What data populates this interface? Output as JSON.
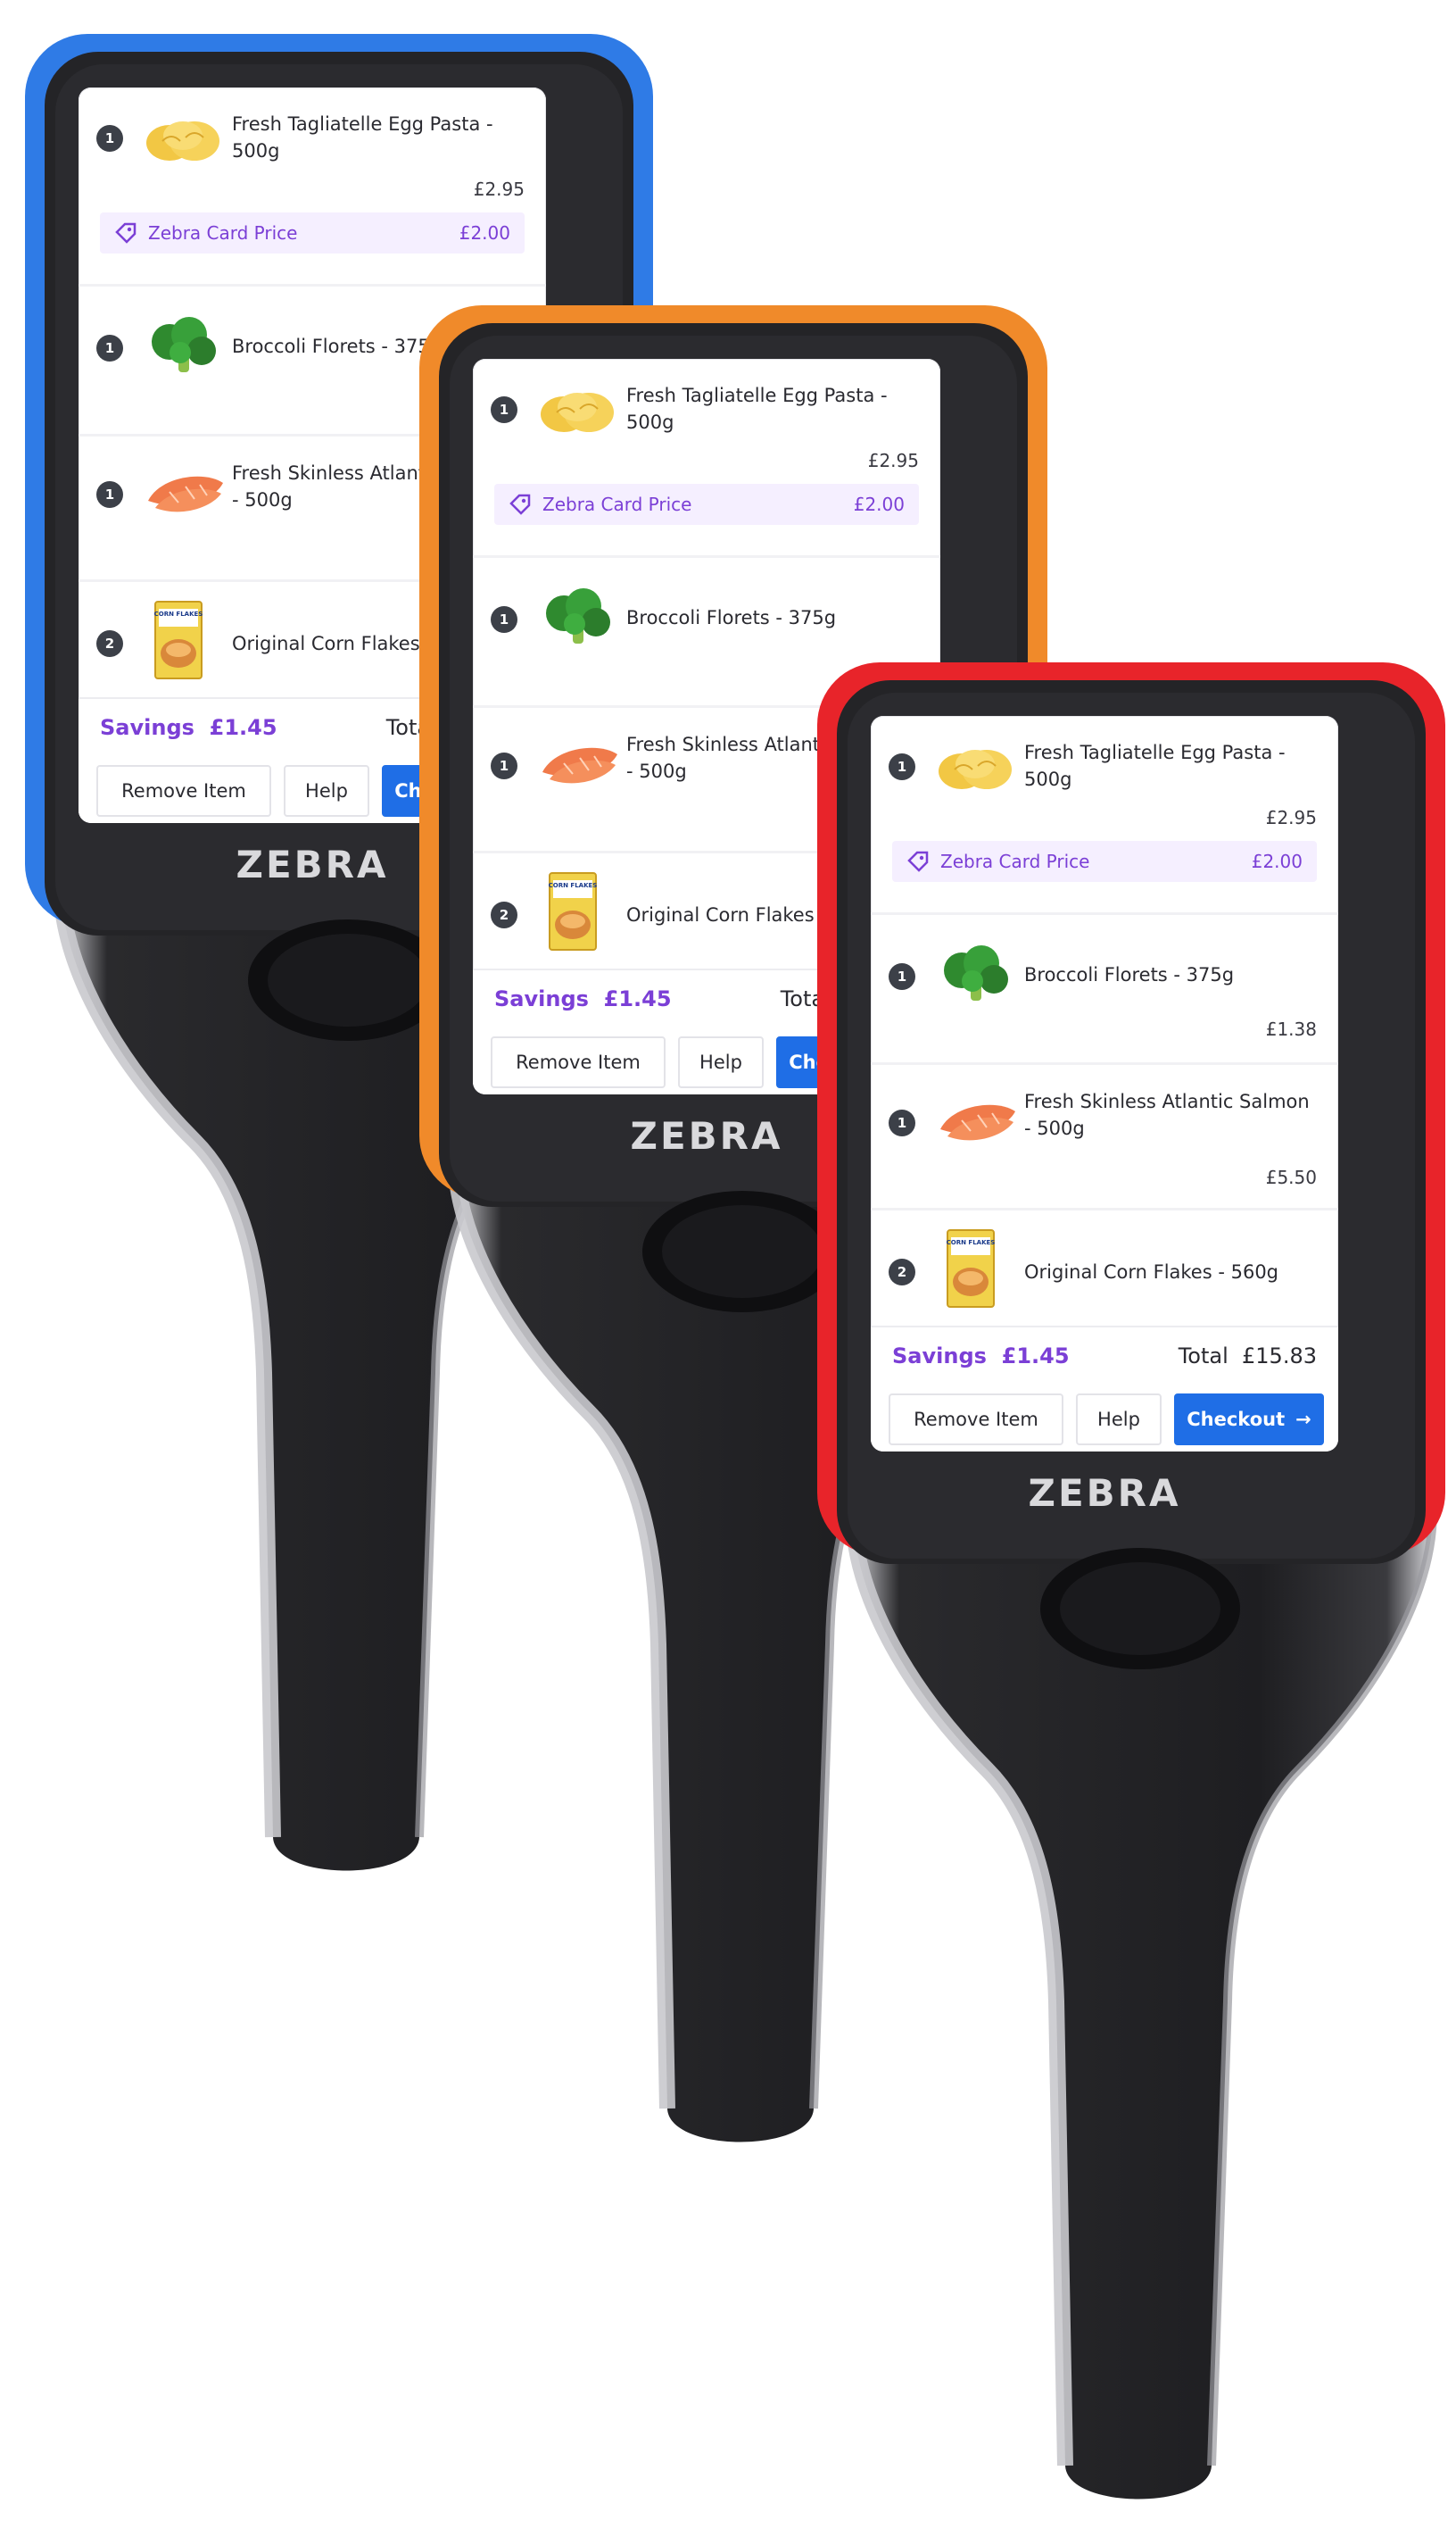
{
  "brand": {
    "name": "ZEBRA"
  },
  "cart": {
    "items": [
      {
        "qty": "1",
        "name": "Fresh Tagliatelle Egg Pasta - 500g",
        "price": "£2.95",
        "promo_label": "Zebra Card Price",
        "promo_price": "£2.00",
        "icon": "pasta-icon"
      },
      {
        "qty": "1",
        "name": "Broccoli Florets - 375g",
        "price": "£1.38",
        "icon": "broccoli-icon"
      },
      {
        "qty": "1",
        "name": "Fresh Skinless Atlantic Salmon - 500g",
        "price": "£5.50",
        "icon": "salmon-icon"
      },
      {
        "qty": "2",
        "name": "Original Corn Flakes - 560g",
        "price": "",
        "icon": "cereal-box-icon",
        "box_text": "CORN FLAKES"
      }
    ],
    "savings_label": "Savings",
    "savings_value": "£1.45",
    "total_label": "Total",
    "total_value": "£15.83",
    "buttons": {
      "remove": "Remove Item",
      "help": "Help",
      "checkout": "Checkout",
      "checkout_icon": "→"
    }
  },
  "colors": {
    "bumper_blue": "#2f7be6",
    "bumper_orange": "#f08a2a",
    "bumper_red": "#e8242a",
    "accent_purple": "#7b3fd6",
    "checkout_blue": "#1f6ee6",
    "body": "#1f1f22"
  }
}
